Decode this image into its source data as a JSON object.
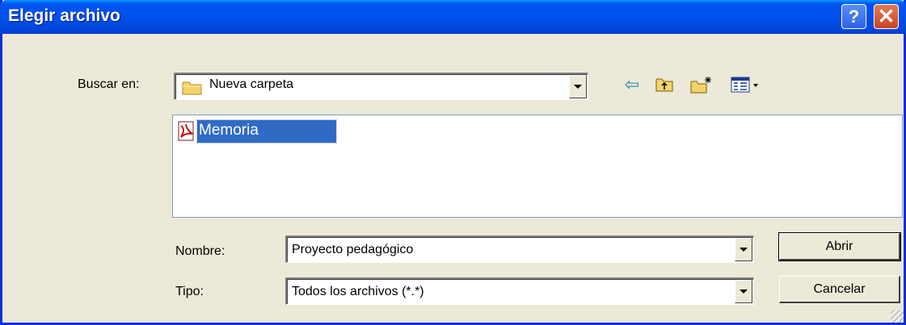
{
  "window": {
    "title": "Elegir archivo"
  },
  "title_buttons": {
    "help": "?",
    "close": "✕"
  },
  "look_in": {
    "label": "Buscar en:",
    "value": "Nueva carpeta"
  },
  "toolbar": {
    "back_glyph": "⇦"
  },
  "file_list": {
    "items": [
      {
        "name": "Memoria",
        "icon": "pdf-file-icon",
        "selected": true
      }
    ]
  },
  "filename": {
    "label": "Nombre:",
    "value": "Proyecto pedagógico"
  },
  "filetype": {
    "label": "Tipo:",
    "value": "Todos los archivos (*.*)"
  },
  "buttons": {
    "open": "Abrir",
    "cancel": "Cancelar"
  },
  "colors": {
    "titlebar": "#0054e3",
    "selection": "#316ac5",
    "dialog_bg": "#ece9d8"
  }
}
